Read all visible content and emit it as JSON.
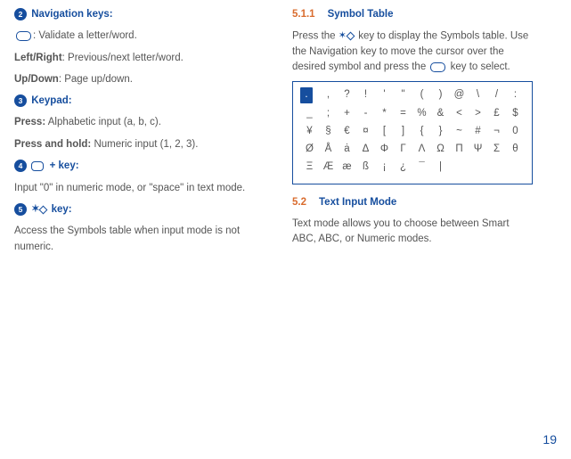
{
  "left": {
    "m2_lead": "Navigation keys:",
    "m2_body": ": Validate a letter/word.",
    "lr_b": "Left/Right",
    "lr_t": ": Previous/next letter/word.",
    "ud_b": "Up/Down",
    "ud_t": ": Page up/down.",
    "m3_lead": "Keypad:",
    "pr_b": "Press:",
    "pr_t": " Alphabetic input (a, b, c).",
    "ph_b": "Press and hold:",
    "ph_t": " Numeric input (1, 2, 3).",
    "m4_tail": "key:",
    "m4_body": "Input \"0\" in numeric mode, or \"space\" in text mode.",
    "m5_tail": "key:",
    "m5_body": "Access the Symbols table when input mode is not numeric."
  },
  "right": {
    "h1n": "5.1.1",
    "h1t": "Symbol Table",
    "p1a": "Press the ",
    "p1b": " key to display the Symbols table. Use the Navigation key to move the cursor over the desired symbol and press the ",
    "p1c": " key to select.",
    "h2n": "5.2",
    "h2t": "Text Input Mode",
    "p2": "Text mode allows you to choose between Smart ABC, ABC, or Numeric modes."
  },
  "symbols": {
    "r1": [
      ".",
      ",",
      "?",
      "!",
      "'",
      "\"",
      "(",
      ")",
      "@",
      "\\",
      "/",
      ":"
    ],
    "r2": [
      "_",
      ";",
      "+",
      "-",
      "*",
      "=",
      "%",
      "&",
      "<",
      ">",
      "£",
      "$"
    ],
    "r3": [
      "¥",
      "§",
      "€",
      "¤",
      "[",
      "]",
      "{",
      "}",
      "~",
      "#",
      "¬",
      "0"
    ],
    "r4": [
      "Ø",
      "Å",
      "ȧ",
      "Δ",
      "Φ",
      "Γ",
      "Λ",
      "Ω",
      "Π",
      "Ψ",
      "Σ",
      "θ"
    ],
    "r5": [
      "Ξ",
      "Æ",
      "æ",
      "ß",
      "¡",
      "¿",
      "¯",
      "|"
    ]
  },
  "pagenum": "19"
}
